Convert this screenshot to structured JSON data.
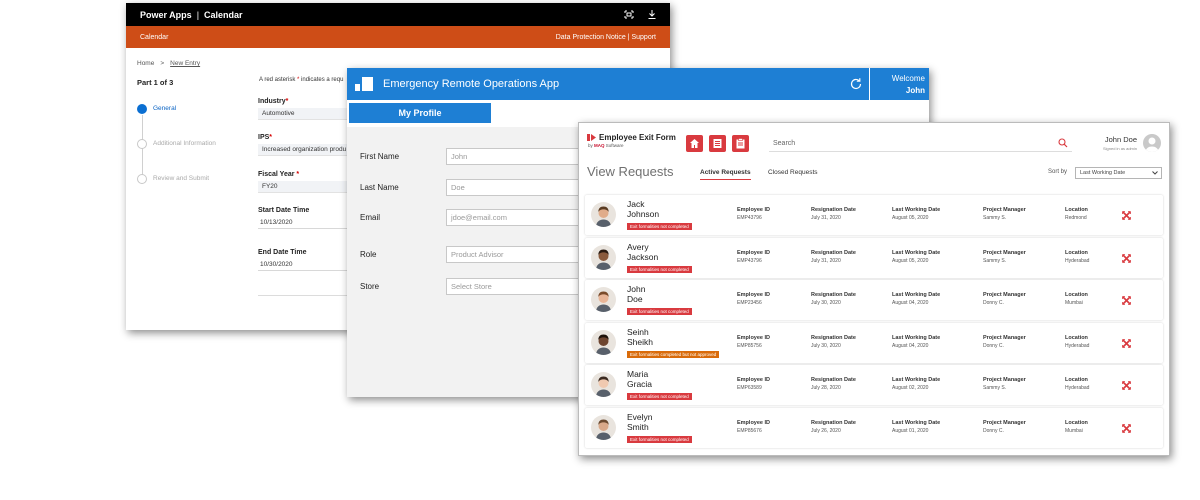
{
  "calendar_window": {
    "app_name": "Power Apps",
    "separator": "|",
    "page_name": "Calendar",
    "orange_bar_left": "Calendar",
    "orange_bar_right": "Data Protection Notice | Support",
    "breadcrumb": {
      "home": "Home",
      "sep": ">",
      "current": "New Entry"
    },
    "part_label": "Part 1 of 3",
    "steps": [
      "General",
      "Additional Information",
      "Review and Submit"
    ],
    "notice": "A red asterisk",
    "notice_star": "*",
    "notice_rest": "indicates a requ",
    "required_star": "*",
    "fields": {
      "industry": {
        "label": "Industry",
        "value": "Automotive"
      },
      "ips": {
        "label": "IPS",
        "value": "Increased organization produ"
      },
      "fiscal_year": {
        "label": "Fiscal Year",
        "value": "FY20"
      },
      "start": {
        "label": "Start Date Time",
        "value": "10/13/2020"
      },
      "end": {
        "label": "End Date Time",
        "value": "10/30/2020"
      }
    }
  },
  "ops_window": {
    "title": "Emergency Remote Operations App",
    "welcome": "Welcome",
    "user": "John",
    "tab": "My Profile",
    "rows": [
      {
        "label": "First Name",
        "placeholder": "John"
      },
      {
        "label": "Last Name",
        "placeholder": "Doe"
      },
      {
        "label": "Email",
        "placeholder": "jdoe@email.com"
      },
      {
        "label": "Role",
        "placeholder": "Product Advisor"
      },
      {
        "label": "Store",
        "placeholder": "Select Store"
      }
    ]
  },
  "exit_window": {
    "brand": "Employee Exit Form",
    "brand_by": "by",
    "brand_company": "MAQ",
    "brand_suffix": "Software",
    "search_placeholder": "Search",
    "user_name": "John Doe",
    "user_status": "Signed in as admin",
    "view_title": "View Requests",
    "tabs": {
      "active": "Active Requests",
      "closed": "Closed Requests"
    },
    "sort_label": "Sort by",
    "sort_value": "Last Working Date",
    "col_headers": {
      "emp_id": "Employee ID",
      "resignation": "Resignation Date",
      "last_working": "Last Working Date",
      "manager": "Project Manager",
      "location": "Location"
    },
    "employees": [
      {
        "first": "Jack",
        "last": "Johnson",
        "badge": "Exit formalities not completed",
        "badge_color": "#d93a3f",
        "emp_id": "EMP43796",
        "resignation": "July 31, 2020",
        "last_working": "August 05, 2020",
        "manager": "Sammy S.",
        "location": "Redmond",
        "skin": "#e0ac8a",
        "hair": "#5a3b22"
      },
      {
        "first": "Avery",
        "last": "Jackson",
        "badge": "Exit formalities not completed",
        "badge_color": "#d93a3f",
        "emp_id": "EMP43796",
        "resignation": "July 31, 2020",
        "last_working": "August 05, 2020",
        "manager": "Sammy S.",
        "location": "Hyderabad",
        "skin": "#8a5a3c",
        "hair": "#2a1a10"
      },
      {
        "first": "John",
        "last": "Doe",
        "badge": "Exit formalities not completed",
        "badge_color": "#d93a3f",
        "emp_id": "EMP23456",
        "resignation": "July 30, 2020",
        "last_working": "August 04, 2020",
        "manager": "Donny C.",
        "location": "Mumbai",
        "skin": "#e8b597",
        "hair": "#7a4b2a"
      },
      {
        "first": "Seinh",
        "last": "Sheikh",
        "badge": "Exit formalities completed but not approved",
        "badge_color": "#d96b0a",
        "emp_id": "EMP85756",
        "resignation": "July 30, 2020",
        "last_working": "August 04, 2020",
        "manager": "Donny C.",
        "location": "Hyderabad",
        "skin": "#6e4530",
        "hair": "#1e120a"
      },
      {
        "first": "Maria",
        "last": "Gracia",
        "badge": "Exit formalities not completed",
        "badge_color": "#d93a3f",
        "emp_id": "EMP63589",
        "resignation": "July 28, 2020",
        "last_working": "August 02, 2020",
        "manager": "Sammy S.",
        "location": "Hyderabad",
        "skin": "#f0c9b0",
        "hair": "#3b2a20"
      },
      {
        "first": "Evelyn",
        "last": "Smith",
        "badge": "Exit formalities not completed",
        "badge_color": "#d93a3f",
        "emp_id": "EMP85676",
        "resignation": "July 26, 2020",
        "last_working": "August 01, 2020",
        "manager": "Donny C.",
        "location": "Mumbai",
        "skin": "#d9a98a",
        "hair": "#6b4a30"
      }
    ]
  }
}
